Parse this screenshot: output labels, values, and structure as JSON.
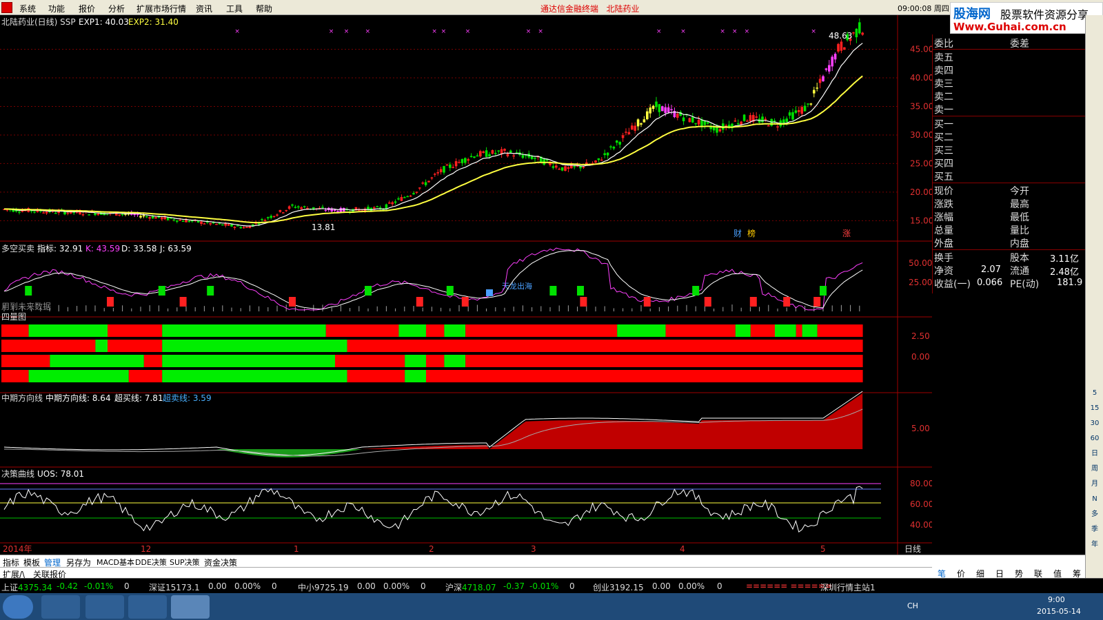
{
  "menubar": {
    "items": [
      "系统",
      "功能",
      "报价",
      "分析",
      "扩展市场行情",
      "资讯",
      "工具",
      "帮助"
    ],
    "app_title": "通达信金融终端",
    "stock_name": "北陆药业",
    "clock": "09:00:08 周四"
  },
  "banner": {
    "site": "股海网",
    "slogan": "股票软件资源分享",
    "url": "Www.Guhai.com.cn"
  },
  "main_chart": {
    "header_title": "北陆药业(日线) SSP",
    "exp1_label": "EXP1: 40.03",
    "exp2_label": "EXP2: 31.40",
    "high_label": "48.63",
    "low_label": "13.81",
    "price_axis": [
      "45.00",
      "40.00",
      "35.00",
      "30.00",
      "25.00",
      "20.00",
      "15.00"
    ],
    "markers": [
      "财",
      "榜",
      "涨"
    ]
  },
  "panel2": {
    "title": "多空买卖",
    "index_label": "指标: 32.91",
    "k_label": "K: 43.59",
    "d_label": "D: 33.58",
    "j_label": "J: 63.59",
    "note": "用到未来数据",
    "axis": [
      "50.00",
      "25.00"
    ],
    "signal_text": "天龙出海"
  },
  "panel3": {
    "title": "四量图",
    "axis": [
      "2.50",
      "0.00"
    ]
  },
  "panel4": {
    "title": "中期方向线",
    "mid_label": "中期方向线: 8.64",
    "overbuy_label": "超买线: 7.81",
    "oversell_label": "超卖线: 3.59",
    "axis": [
      "5.00"
    ]
  },
  "panel5": {
    "title": "决策曲线",
    "uos_label": "UOS: 78.01",
    "axis": [
      "80.00",
      "60.00",
      "40.00"
    ]
  },
  "time_axis": {
    "labels": [
      "2014年",
      "12",
      "1",
      "2",
      "3",
      "4",
      "5"
    ],
    "period": "日线"
  },
  "zoom_controls": [
    "+",
    "-",
    "0"
  ],
  "quote_panel": {
    "weibi": "委比",
    "weicha": "委差",
    "asks": [
      "卖五",
      "卖四",
      "卖三",
      "卖二",
      "卖一"
    ],
    "bids": [
      "买一",
      "买二",
      "买三",
      "买四",
      "买五"
    ],
    "left_labels": [
      "现价",
      "涨跌",
      "涨幅",
      "总量",
      "外盘"
    ],
    "right_labels": [
      "今开",
      "最高",
      "最低",
      "量比",
      "内盘"
    ],
    "extra": [
      {
        "l": "换手",
        "r": "股本",
        "rv": "3.11亿"
      },
      {
        "l": "净资",
        "lv": "2.07",
        "r": "流通",
        "rv": "2.48亿"
      },
      {
        "l": "收益(一)",
        "lv": "0.066",
        "r": "PE(动)",
        "rv": "181.9"
      }
    ]
  },
  "right_toolbar": [
    "5",
    "15",
    "30",
    "60",
    "日",
    "周",
    "月",
    "N",
    "多",
    "季",
    "年"
  ],
  "tabs": [
    "指标",
    "模板",
    "管理",
    "另存为",
    "MACD基本",
    "DDE决策",
    "SUP决策",
    "资金决策"
  ],
  "tabs2": [
    "扩展/\\",
    "关联报价"
  ],
  "mini_tabs": [
    "笔",
    "价",
    "细",
    "日",
    "势",
    "联",
    "值",
    "筹"
  ],
  "status": {
    "sh": {
      "name": "上证",
      "value": "4375.34",
      "change": "-0.42",
      "pct": "-0.01%",
      "vol": "0"
    },
    "sz": {
      "name": "深证",
      "value": "15173.1",
      "change": "0.00",
      "pct": "0.00%",
      "vol": "0"
    },
    "zx": {
      "name": "中小",
      "value": "9725.19",
      "change": "0.00",
      "pct": "0.00%",
      "vol": "0"
    },
    "hs": {
      "name": "沪深",
      "value": "4718.07",
      "change": "-0.37",
      "pct": "-0.01%",
      "vol": "0"
    },
    "cy": {
      "name": "创业",
      "value": "3192.15",
      "change": "0.00",
      "pct": "0.00%",
      "vol": "0"
    },
    "progress": "====== ======",
    "server": "深圳行情主站1"
  },
  "taskbar": {
    "lang": "CH",
    "time": "9:00",
    "date": "2015-05-14"
  },
  "colors": {
    "up": "#ff2020",
    "down": "#00e000",
    "yellow": "#ffff40",
    "magenta": "#ff40ff",
    "grid": "#7a0000"
  },
  "chart_data": [
    {
      "type": "candlestick",
      "title": "北陆药业(日线)",
      "ylim": [
        13,
        50
      ],
      "price_path": [
        [
          0,
          17
        ],
        [
          20,
          16.5
        ],
        [
          40,
          16.2
        ],
        [
          60,
          15
        ],
        [
          80,
          13.8
        ],
        [
          95,
          17.5
        ],
        [
          110,
          16.8
        ],
        [
          125,
          17.2
        ],
        [
          135,
          20
        ],
        [
          145,
          24
        ],
        [
          155,
          26.5
        ],
        [
          165,
          27
        ],
        [
          175,
          26
        ],
        [
          185,
          24
        ],
        [
          195,
          25
        ],
        [
          205,
          30
        ],
        [
          215,
          35
        ],
        [
          225,
          33
        ],
        [
          235,
          31
        ],
        [
          245,
          33
        ],
        [
          255,
          32
        ],
        [
          265,
          35
        ],
        [
          275,
          45
        ],
        [
          282,
          48.6
        ]
      ],
      "series": [
        {
          "name": "EXP1",
          "last": 40.03
        },
        {
          "name": "EXP2",
          "last": 31.4
        }
      ]
    },
    {
      "type": "line",
      "title": "决策曲线",
      "ylim": [
        28,
        88
      ],
      "series": [
        {
          "name": "UOS",
          "last": 78.01
        }
      ]
    }
  ]
}
